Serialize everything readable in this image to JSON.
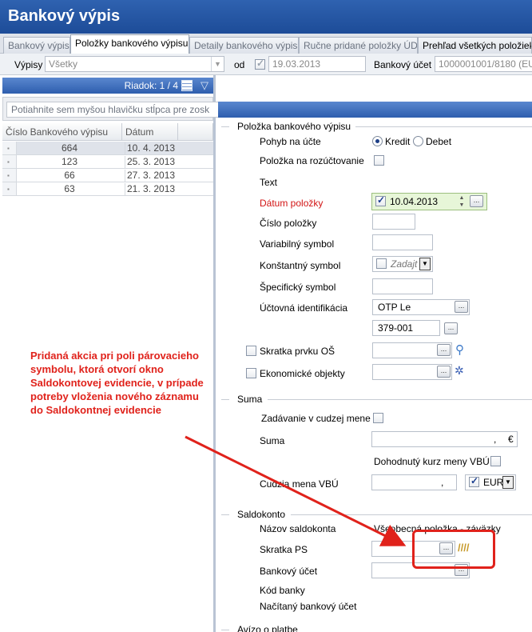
{
  "window": {
    "title": "Bankový výpis"
  },
  "tabs": [
    {
      "label": "Bankový výpis"
    },
    {
      "label": "Položky bankového výpisu"
    },
    {
      "label": "Detaily bankového výpisu"
    },
    {
      "label": "Ručne pridané položky ÚD"
    },
    {
      "label": "Prehľad všetkých položiek"
    }
  ],
  "filter": {
    "vypisy_label": "Výpisy",
    "vypisy_value": "Všetky",
    "od_label": "od",
    "od_date": "19.03.2013",
    "ucet_label": "Bankový účet",
    "ucet_value": "1000001001/8180 (EUR"
  },
  "list": {
    "row_counter": "Riadok: 1 / 4",
    "group_placeholder": "Potiahnite sem myšou hlavičku stĺpca pre zosk",
    "columns": [
      "Číslo Bankového výpisu",
      "Dátum"
    ],
    "rows": [
      {
        "num": "664",
        "date": "10. 4. 2013"
      },
      {
        "num": "123",
        "date": "25. 3. 2013"
      },
      {
        "num": "66",
        "date": "27. 3. 2013"
      },
      {
        "num": "63",
        "date": "21. 3. 2013"
      }
    ]
  },
  "form": {
    "section_item": "Položka bankového výpisu",
    "pohyb_label": "Pohyb na účte",
    "kredit": "Kredit",
    "debet": "Debet",
    "rozuct_label": "Položka na rozúčtovanie",
    "text_label": "Text",
    "datum_label": "Dátum položky",
    "datum_value": "10.04.2013",
    "cislo_label": "Číslo položky",
    "var_label": "Variabilný symbol",
    "konst_label": "Konštantný symbol",
    "konst_placeholder": "Zadajt",
    "spec_label": "Špecifický symbol",
    "uct_id_label": "Účtovná identifikácia",
    "uct_id_value": "OTP Le",
    "uct_id_value2": "379-001",
    "skratka_os_label": "Skratka prvku OŠ",
    "ekon_label": "Ekonomické objekty",
    "section_suma": "Suma",
    "cudzia_label": "Zadávanie v cudzej mene",
    "suma_label": "Suma",
    "suma_value": ",",
    "suma_currency": "€",
    "kurz_label": "Dohodnutý kurz meny VBÚ",
    "cudzia_mena_label": "Cudzia mena VBÚ",
    "cudzia_mena_value": ",",
    "mena_value": "EUR",
    "section_saldo": "Saldokonto",
    "nazov_saldo_label": "Názov saldokonta",
    "nazov_saldo_value": "Všeobecná položka - záväzky",
    "skratka_ps_label": "Skratka PS",
    "bank_ucet_label": "Bankový účet",
    "kod_banky_label": "Kód banky",
    "nacitany_label": "Načítaný bankový účet",
    "section_aviso": "Avízo o platbe"
  },
  "annotation": {
    "text": "Pridaná akcia pri poli párovacieho symbolu, ktorá otvorí okno Saldokontovej evidencie, v prípade potreby vloženia nového záznamu do Saldokontnej evidencie",
    "color": "#e0221b"
  }
}
